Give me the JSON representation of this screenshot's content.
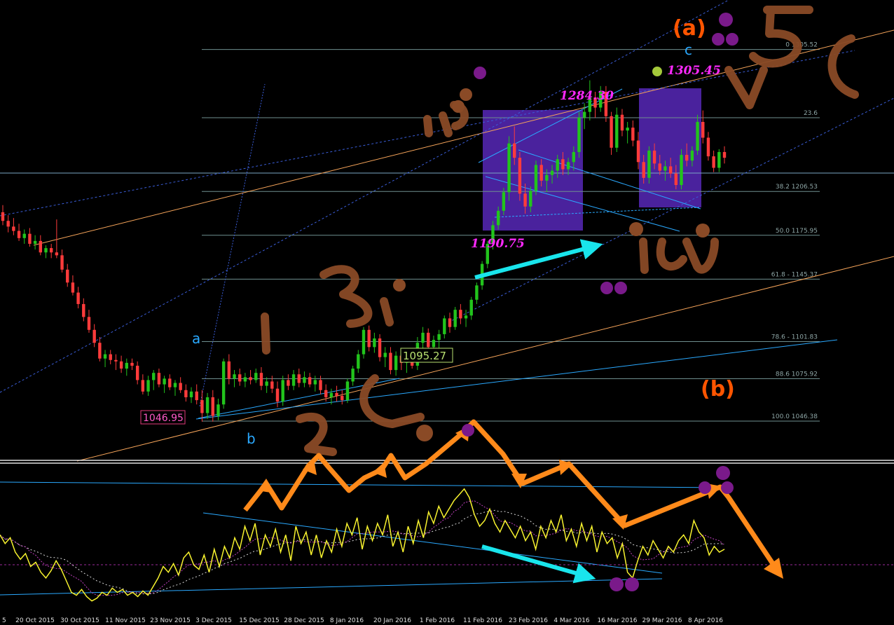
{
  "chart_data": {
    "type": "line",
    "main_panel": {
      "ylim": [
        1020,
        1340
      ],
      "candles": [
        {
          "o": 1192,
          "h": 1197,
          "l": 1183,
          "c": 1186
        },
        {
          "o": 1186,
          "h": 1190,
          "l": 1178,
          "c": 1182
        },
        {
          "o": 1182,
          "h": 1188,
          "l": 1176,
          "c": 1179
        },
        {
          "o": 1179,
          "h": 1184,
          "l": 1172,
          "c": 1174
        },
        {
          "o": 1174,
          "h": 1180,
          "l": 1170,
          "c": 1177
        },
        {
          "o": 1177,
          "h": 1181,
          "l": 1168,
          "c": 1170
        },
        {
          "o": 1170,
          "h": 1176,
          "l": 1166,
          "c": 1172
        },
        {
          "o": 1172,
          "h": 1176,
          "l": 1162,
          "c": 1164
        },
        {
          "o": 1164,
          "h": 1169,
          "l": 1160,
          "c": 1167
        },
        {
          "o": 1167,
          "h": 1170,
          "l": 1160,
          "c": 1164
        },
        {
          "o": 1164,
          "h": 1187,
          "l": 1160,
          "c": 1162
        },
        {
          "o": 1162,
          "h": 1166,
          "l": 1150,
          "c": 1152
        },
        {
          "o": 1152,
          "h": 1156,
          "l": 1140,
          "c": 1143
        },
        {
          "o": 1143,
          "h": 1148,
          "l": 1134,
          "c": 1136
        },
        {
          "o": 1136,
          "h": 1140,
          "l": 1125,
          "c": 1128
        },
        {
          "o": 1128,
          "h": 1132,
          "l": 1116,
          "c": 1119
        },
        {
          "o": 1119,
          "h": 1124,
          "l": 1108,
          "c": 1110
        },
        {
          "o": 1110,
          "h": 1114,
          "l": 1098,
          "c": 1101
        },
        {
          "o": 1101,
          "h": 1105,
          "l": 1088,
          "c": 1090
        },
        {
          "o": 1090,
          "h": 1096,
          "l": 1084,
          "c": 1093
        },
        {
          "o": 1093,
          "h": 1096,
          "l": 1086,
          "c": 1089
        },
        {
          "o": 1089,
          "h": 1093,
          "l": 1082,
          "c": 1088
        },
        {
          "o": 1088,
          "h": 1092,
          "l": 1080,
          "c": 1083
        },
        {
          "o": 1083,
          "h": 1090,
          "l": 1078,
          "c": 1087
        },
        {
          "o": 1087,
          "h": 1090,
          "l": 1082,
          "c": 1085
        },
        {
          "o": 1085,
          "h": 1088,
          "l": 1072,
          "c": 1075
        },
        {
          "o": 1075,
          "h": 1079,
          "l": 1065,
          "c": 1067
        },
        {
          "o": 1067,
          "h": 1078,
          "l": 1064,
          "c": 1075
        },
        {
          "o": 1075,
          "h": 1082,
          "l": 1068,
          "c": 1080
        },
        {
          "o": 1080,
          "h": 1083,
          "l": 1070,
          "c": 1072
        },
        {
          "o": 1072,
          "h": 1078,
          "l": 1066,
          "c": 1076
        },
        {
          "o": 1076,
          "h": 1079,
          "l": 1068,
          "c": 1070
        },
        {
          "o": 1070,
          "h": 1075,
          "l": 1064,
          "c": 1073
        },
        {
          "o": 1073,
          "h": 1077,
          "l": 1066,
          "c": 1068
        },
        {
          "o": 1068,
          "h": 1072,
          "l": 1060,
          "c": 1063
        },
        {
          "o": 1063,
          "h": 1070,
          "l": 1059,
          "c": 1067
        },
        {
          "o": 1067,
          "h": 1072,
          "l": 1058,
          "c": 1061
        },
        {
          "o": 1061,
          "h": 1068,
          "l": 1046,
          "c": 1052
        },
        {
          "o": 1052,
          "h": 1066,
          "l": 1048,
          "c": 1063
        },
        {
          "o": 1063,
          "h": 1068,
          "l": 1046,
          "c": 1050
        },
        {
          "o": 1050,
          "h": 1062,
          "l": 1047,
          "c": 1058
        },
        {
          "o": 1058,
          "h": 1090,
          "l": 1055,
          "c": 1088
        },
        {
          "o": 1088,
          "h": 1093,
          "l": 1072,
          "c": 1076
        },
        {
          "o": 1076,
          "h": 1082,
          "l": 1070,
          "c": 1079
        },
        {
          "o": 1079,
          "h": 1083,
          "l": 1071,
          "c": 1074
        },
        {
          "o": 1074,
          "h": 1080,
          "l": 1070,
          "c": 1077
        },
        {
          "o": 1077,
          "h": 1082,
          "l": 1072,
          "c": 1075
        },
        {
          "o": 1075,
          "h": 1083,
          "l": 1073,
          "c": 1080
        },
        {
          "o": 1080,
          "h": 1084,
          "l": 1068,
          "c": 1071
        },
        {
          "o": 1071,
          "h": 1077,
          "l": 1066,
          "c": 1074
        },
        {
          "o": 1074,
          "h": 1078,
          "l": 1066,
          "c": 1069
        },
        {
          "o": 1069,
          "h": 1074,
          "l": 1056,
          "c": 1060
        },
        {
          "o": 1060,
          "h": 1078,
          "l": 1057,
          "c": 1075
        },
        {
          "o": 1075,
          "h": 1079,
          "l": 1068,
          "c": 1071
        },
        {
          "o": 1071,
          "h": 1082,
          "l": 1068,
          "c": 1079
        },
        {
          "o": 1079,
          "h": 1083,
          "l": 1070,
          "c": 1073
        },
        {
          "o": 1073,
          "h": 1081,
          "l": 1070,
          "c": 1077
        },
        {
          "o": 1077,
          "h": 1080,
          "l": 1070,
          "c": 1072
        },
        {
          "o": 1072,
          "h": 1078,
          "l": 1067,
          "c": 1075
        },
        {
          "o": 1075,
          "h": 1078,
          "l": 1065,
          "c": 1068
        },
        {
          "o": 1068,
          "h": 1072,
          "l": 1060,
          "c": 1063
        },
        {
          "o": 1063,
          "h": 1069,
          "l": 1058,
          "c": 1066
        },
        {
          "o": 1066,
          "h": 1071,
          "l": 1060,
          "c": 1064
        },
        {
          "o": 1064,
          "h": 1068,
          "l": 1058,
          "c": 1061
        },
        {
          "o": 1061,
          "h": 1076,
          "l": 1059,
          "c": 1074
        },
        {
          "o": 1074,
          "h": 1085,
          "l": 1071,
          "c": 1083
        },
        {
          "o": 1083,
          "h": 1096,
          "l": 1080,
          "c": 1093
        },
        {
          "o": 1093,
          "h": 1112,
          "l": 1090,
          "c": 1110
        },
        {
          "o": 1110,
          "h": 1113,
          "l": 1095,
          "c": 1098
        },
        {
          "o": 1098,
          "h": 1108,
          "l": 1094,
          "c": 1104
        },
        {
          "o": 1104,
          "h": 1107,
          "l": 1088,
          "c": 1091
        },
        {
          "o": 1091,
          "h": 1098,
          "l": 1084,
          "c": 1094
        },
        {
          "o": 1094,
          "h": 1098,
          "l": 1079,
          "c": 1082
        },
        {
          "o": 1082,
          "h": 1095,
          "l": 1078,
          "c": 1092
        },
        {
          "o": 1092,
          "h": 1096,
          "l": 1082,
          "c": 1087
        },
        {
          "o": 1087,
          "h": 1092,
          "l": 1080,
          "c": 1089
        },
        {
          "o": 1089,
          "h": 1094,
          "l": 1083,
          "c": 1085
        },
        {
          "o": 1085,
          "h": 1105,
          "l": 1082,
          "c": 1101
        },
        {
          "o": 1101,
          "h": 1112,
          "l": 1097,
          "c": 1108
        },
        {
          "o": 1108,
          "h": 1111,
          "l": 1094,
          "c": 1098
        },
        {
          "o": 1098,
          "h": 1106,
          "l": 1094,
          "c": 1103
        },
        {
          "o": 1103,
          "h": 1110,
          "l": 1096,
          "c": 1107
        },
        {
          "o": 1107,
          "h": 1120,
          "l": 1104,
          "c": 1118
        },
        {
          "o": 1118,
          "h": 1122,
          "l": 1108,
          "c": 1112
        },
        {
          "o": 1112,
          "h": 1126,
          "l": 1110,
          "c": 1124
        },
        {
          "o": 1124,
          "h": 1128,
          "l": 1114,
          "c": 1118
        },
        {
          "o": 1118,
          "h": 1124,
          "l": 1112,
          "c": 1120
        },
        {
          "o": 1120,
          "h": 1133,
          "l": 1117,
          "c": 1131
        },
        {
          "o": 1131,
          "h": 1143,
          "l": 1128,
          "c": 1141
        },
        {
          "o": 1141,
          "h": 1158,
          "l": 1138,
          "c": 1156
        },
        {
          "o": 1156,
          "h": 1172,
          "l": 1153,
          "c": 1170
        },
        {
          "o": 1170,
          "h": 1186,
          "l": 1166,
          "c": 1183
        },
        {
          "o": 1183,
          "h": 1196,
          "l": 1180,
          "c": 1193
        },
        {
          "o": 1193,
          "h": 1209,
          "l": 1190,
          "c": 1206
        },
        {
          "o": 1206,
          "h": 1245,
          "l": 1200,
          "c": 1240
        },
        {
          "o": 1240,
          "h": 1252,
          "l": 1225,
          "c": 1230
        },
        {
          "o": 1230,
          "h": 1234,
          "l": 1200,
          "c": 1205
        },
        {
          "o": 1205,
          "h": 1212,
          "l": 1191,
          "c": 1196
        },
        {
          "o": 1196,
          "h": 1210,
          "l": 1192,
          "c": 1207
        },
        {
          "o": 1207,
          "h": 1228,
          "l": 1204,
          "c": 1225
        },
        {
          "o": 1225,
          "h": 1229,
          "l": 1210,
          "c": 1214
        },
        {
          "o": 1214,
          "h": 1222,
          "l": 1206,
          "c": 1218
        },
        {
          "o": 1218,
          "h": 1225,
          "l": 1212,
          "c": 1221
        },
        {
          "o": 1221,
          "h": 1232,
          "l": 1216,
          "c": 1229
        },
        {
          "o": 1229,
          "h": 1234,
          "l": 1218,
          "c": 1222
        },
        {
          "o": 1222,
          "h": 1230,
          "l": 1218,
          "c": 1227
        },
        {
          "o": 1227,
          "h": 1238,
          "l": 1221,
          "c": 1234
        },
        {
          "o": 1234,
          "h": 1262,
          "l": 1230,
          "c": 1258
        },
        {
          "o": 1258,
          "h": 1268,
          "l": 1250,
          "c": 1262
        },
        {
          "o": 1262,
          "h": 1284,
          "l": 1256,
          "c": 1272
        },
        {
          "o": 1272,
          "h": 1276,
          "l": 1258,
          "c": 1265
        },
        {
          "o": 1265,
          "h": 1280,
          "l": 1262,
          "c": 1276
        },
        {
          "o": 1276,
          "h": 1280,
          "l": 1255,
          "c": 1259
        },
        {
          "o": 1259,
          "h": 1262,
          "l": 1232,
          "c": 1237
        },
        {
          "o": 1237,
          "h": 1265,
          "l": 1234,
          "c": 1260
        },
        {
          "o": 1260,
          "h": 1264,
          "l": 1245,
          "c": 1249
        },
        {
          "o": 1249,
          "h": 1255,
          "l": 1240,
          "c": 1251
        },
        {
          "o": 1251,
          "h": 1256,
          "l": 1238,
          "c": 1242
        },
        {
          "o": 1242,
          "h": 1248,
          "l": 1222,
          "c": 1227
        },
        {
          "o": 1227,
          "h": 1232,
          "l": 1212,
          "c": 1216
        },
        {
          "o": 1216,
          "h": 1238,
          "l": 1212,
          "c": 1235
        },
        {
          "o": 1235,
          "h": 1240,
          "l": 1222,
          "c": 1226
        },
        {
          "o": 1226,
          "h": 1232,
          "l": 1218,
          "c": 1221
        },
        {
          "o": 1221,
          "h": 1228,
          "l": 1214,
          "c": 1224
        },
        {
          "o": 1224,
          "h": 1230,
          "l": 1216,
          "c": 1219
        },
        {
          "o": 1219,
          "h": 1225,
          "l": 1208,
          "c": 1211
        },
        {
          "o": 1211,
          "h": 1236,
          "l": 1208,
          "c": 1232
        },
        {
          "o": 1232,
          "h": 1240,
          "l": 1224,
          "c": 1228
        },
        {
          "o": 1228,
          "h": 1238,
          "l": 1224,
          "c": 1235
        },
        {
          "o": 1235,
          "h": 1260,
          "l": 1232,
          "c": 1255
        },
        {
          "o": 1255,
          "h": 1263,
          "l": 1240,
          "c": 1244
        },
        {
          "o": 1244,
          "h": 1248,
          "l": 1228,
          "c": 1231
        },
        {
          "o": 1231,
          "h": 1235,
          "l": 1220,
          "c": 1223
        },
        {
          "o": 1223,
          "h": 1236,
          "l": 1220,
          "c": 1234
        },
        {
          "o": 1234,
          "h": 1238,
          "l": 1226,
          "c": 1230
        }
      ],
      "last_price": 1230.7,
      "fib_levels": [
        {
          "label": "0 1305.52",
          "value": 1305.52
        },
        {
          "label": "23.6",
          "value": 1257.9
        },
        {
          "label": "38.2 1206.53",
          "value": 1206.53
        },
        {
          "label": "50.0 1175.95",
          "value": 1175.95
        },
        {
          "label": "61.8 - 1145.37",
          "value": 1145.37
        },
        {
          "label": "78.6 - 1101.83",
          "value": 1101.83
        },
        {
          "label": "88.6 1075.92",
          "value": 1075.92
        },
        {
          "label": "100.0 1046.38",
          "value": 1046.38
        }
      ]
    },
    "oscillator_panel": {
      "ylim": [
        0,
        100
      ],
      "values": [
        52,
        46,
        50,
        40,
        35,
        39,
        30,
        33,
        26,
        22,
        27,
        34,
        28,
        20,
        12,
        10,
        14,
        9,
        6,
        8,
        12,
        10,
        15,
        12,
        14,
        10,
        12,
        9,
        13,
        10,
        16,
        22,
        30,
        26,
        32,
        24,
        36,
        40,
        31,
        28,
        38,
        26,
        42,
        30,
        44,
        36,
        50,
        42,
        58,
        48,
        60,
        38,
        52,
        44,
        56,
        40,
        52,
        34,
        58,
        46,
        54,
        38,
        52,
        36,
        48,
        40,
        56,
        44,
        60,
        52,
        64,
        42,
        58,
        48,
        60,
        52,
        66,
        44,
        54,
        40,
        58,
        46,
        62,
        50,
        68,
        60,
        72,
        64,
        70,
        76,
        80,
        84,
        78,
        66,
        58,
        62,
        70,
        60,
        54,
        62,
        56,
        50,
        58,
        48,
        54,
        42,
        58,
        50,
        62,
        54,
        66,
        48,
        56,
        44,
        60,
        48,
        58,
        40,
        54,
        46,
        50,
        36,
        46,
        26,
        22,
        34,
        44,
        38,
        48,
        42,
        36,
        44,
        40,
        48,
        52,
        46,
        62,
        54,
        50,
        38,
        44,
        40,
        42
      ]
    },
    "x_tick_labels": [
      "5",
      "20 Oct 2015",
      "30 Oct 2015",
      "11 Nov 2015",
      "23 Nov 2015",
      "3 Dec 2015",
      "15 Dec 2015",
      "28 Dec 2015",
      "8 Jan 2016",
      "20 Jan 2016",
      "1 Feb 2016",
      "11 Feb 2016",
      "23 Feb 2016",
      "4 Mar 2016",
      "16 Mar 2016",
      "29 Mar 2016",
      "8 Apr 2016"
    ],
    "price_labels": {
      "low": "1046.95",
      "mid": "1095.27",
      "feb_low": "1190.75",
      "mar_high": "1284.30",
      "target": "1305.45"
    },
    "wave_labels": {
      "a": "a",
      "b": "b",
      "c": "c",
      "wave_a": "(a)",
      "wave_b": "(b)"
    },
    "colors": {
      "bull": "#22c41c",
      "bear": "#ff3b3b",
      "fib": "#6f8f8f",
      "box": "#4a229d",
      "ann_pink": "#ff29ff",
      "ann_cyan": "#19e5ec",
      "ann_orange": "#ff8a1a",
      "trend_orange": "#f7a55a",
      "trend_blue": "#3a5dd8",
      "wave_orange": "#ff5500",
      "wave_blue": "#2aa9ff",
      "scribble": "#8a4a26",
      "dot": "#7a1a8a",
      "osc": "#f7f22e"
    }
  }
}
